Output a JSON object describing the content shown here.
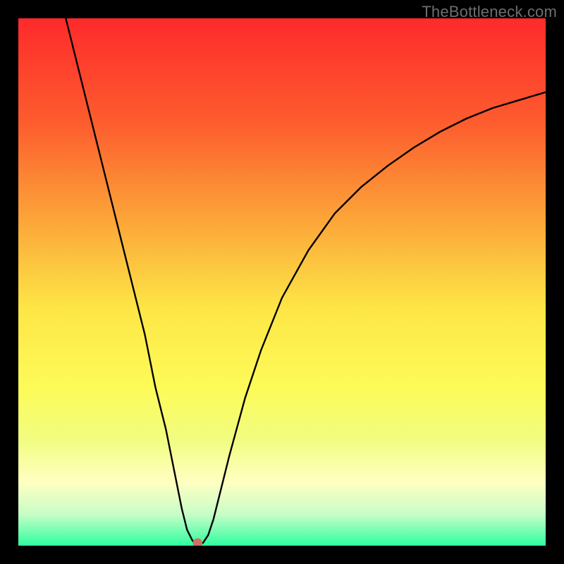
{
  "watermark": {
    "text": "TheBottleneck.com"
  },
  "chart_data": {
    "type": "line",
    "title": "",
    "xlabel": "",
    "ylabel": "",
    "xlim": [
      0,
      100
    ],
    "ylim": [
      0,
      100
    ],
    "grid": false,
    "x": [
      9.0,
      12,
      15,
      18,
      21,
      24,
      26,
      28,
      30,
      31,
      32,
      33,
      33.5,
      34,
      35,
      36,
      37,
      38,
      40,
      43,
      46,
      50,
      55,
      60,
      65,
      70,
      75,
      80,
      85,
      90,
      95,
      100
    ],
    "values": [
      100,
      88,
      76,
      64,
      52,
      40,
      30,
      22,
      12,
      7,
      3,
      1,
      0.5,
      0.5,
      0.5,
      2,
      5,
      9,
      17,
      28,
      37,
      47,
      56,
      63,
      68,
      72,
      75.5,
      78.5,
      81,
      83,
      84.5,
      86
    ],
    "marker": {
      "x": 34,
      "y": 0.5,
      "color": "#d07060"
    },
    "background_gradient_stops": [
      {
        "offset": 0.0,
        "color": "#fe2a2b"
      },
      {
        "offset": 0.2,
        "color": "#fd5d2e"
      },
      {
        "offset": 0.4,
        "color": "#fca范3a"
      },
      {
        "offset": 0.55,
        "color": "#fde646"
      },
      {
        "offset": 0.7,
        "color": "#fdfb58"
      },
      {
        "offset": 0.8,
        "color": "#f1fd81"
      },
      {
        "offset": 0.88,
        "color": "#ffffc2"
      },
      {
        "offset": 0.94,
        "color": "#c8fec7"
      },
      {
        "offset": 1.0,
        "color": "#2efea0"
      }
    ]
  }
}
